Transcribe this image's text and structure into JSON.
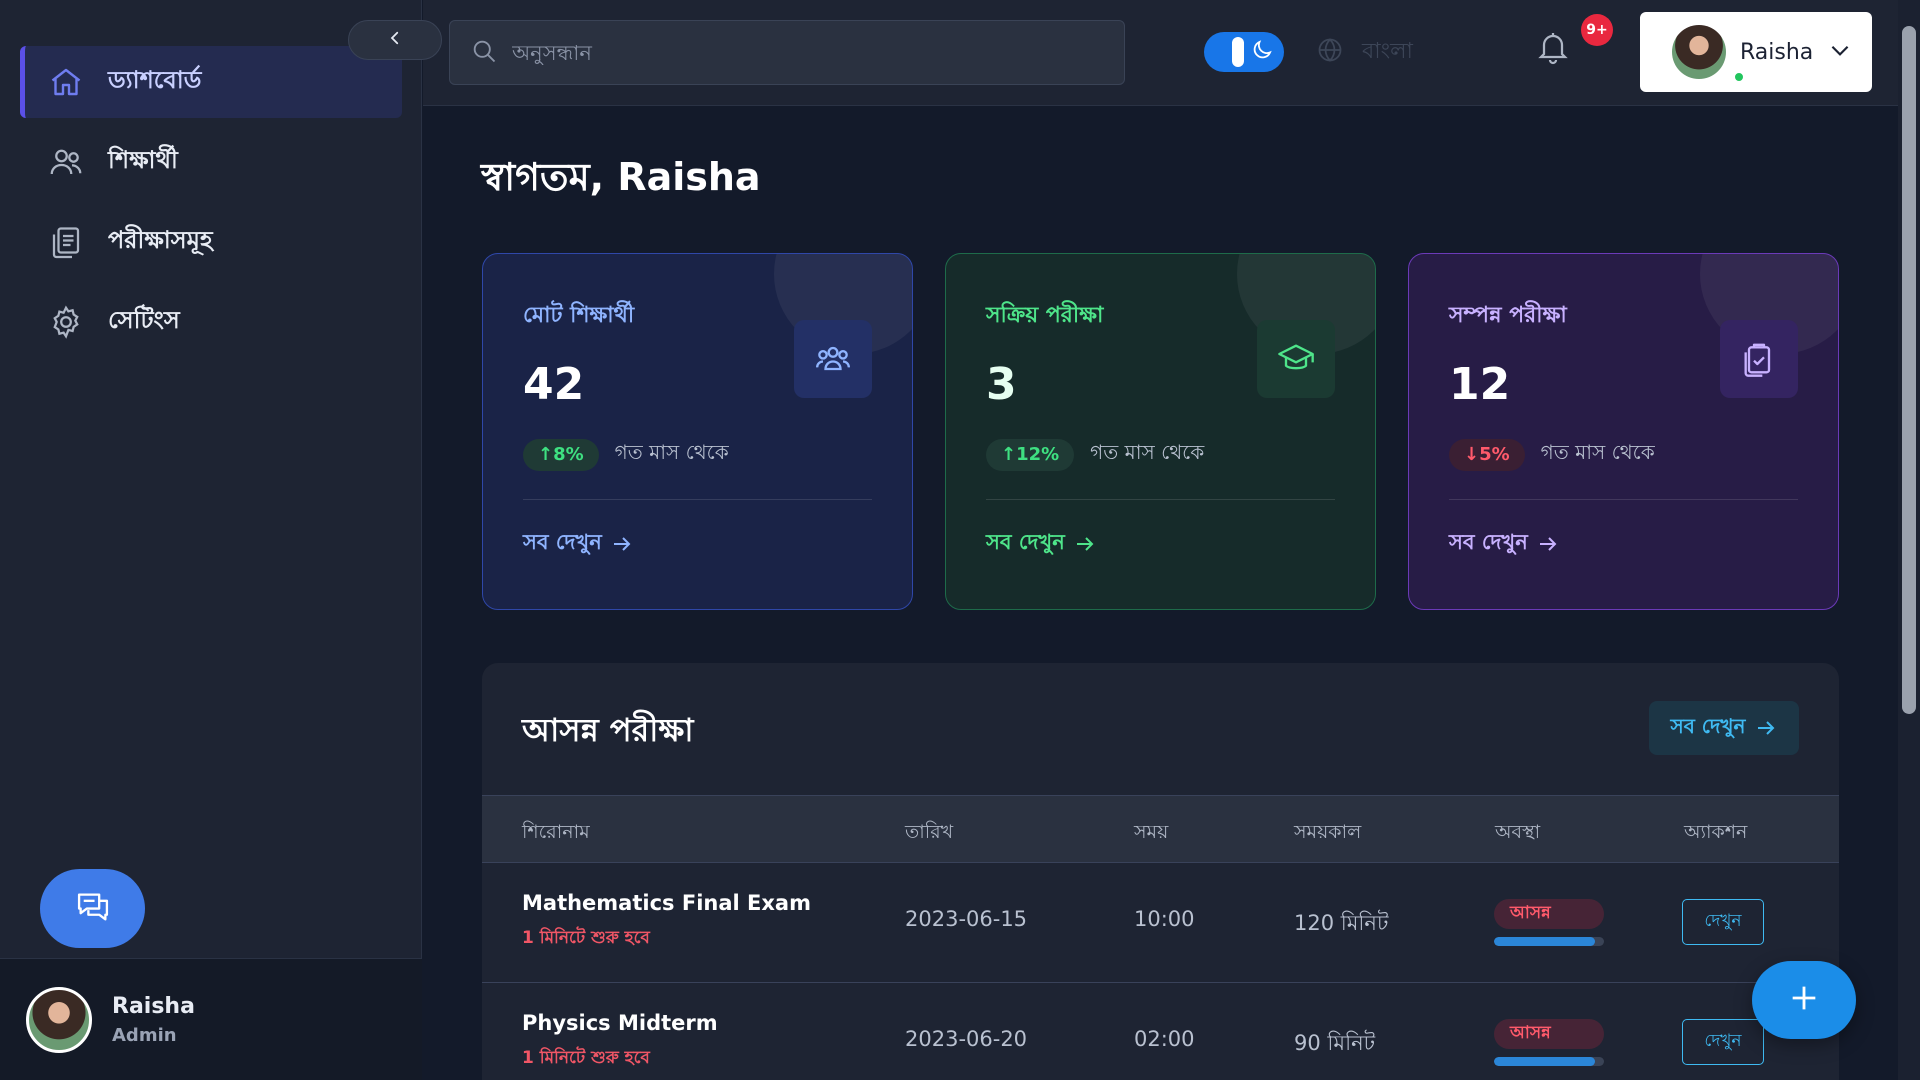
{
  "sidebar": {
    "items": [
      {
        "label": "ড্যাশবোর্ড",
        "icon": "home-icon",
        "active": true
      },
      {
        "label": "শিক্ষার্থী",
        "icon": "users-icon",
        "active": false
      },
      {
        "label": "পরীক্ষাসমূহ",
        "icon": "clipboard-list-icon",
        "active": false
      },
      {
        "label": "সেটিংস",
        "icon": "gear-icon",
        "active": false
      }
    ],
    "chat_icon": "chat-bubbles-icon",
    "user": {
      "name": "Raisha",
      "role": "Admin"
    }
  },
  "topbar": {
    "search": {
      "placeholder": "অনুসন্ধান",
      "value": ""
    },
    "theme": "dark",
    "language": "বাংলা",
    "notifications_badge": "9+",
    "user_name": "Raisha",
    "online": true
  },
  "welcome": "স্বাগতম, Raisha",
  "stats": [
    {
      "title": "মোট শিক্ষার্থী",
      "value": "42",
      "trend": "↑8%",
      "trend_dir": "up",
      "since": "গত মাস থেকে",
      "more": "সব দেখুন",
      "icon": "users-group-icon",
      "accent": "#8fb4ff"
    },
    {
      "title": "সক্রিয় পরীক্ষা",
      "value": "3",
      "trend": "↑12%",
      "trend_dir": "up",
      "since": "গত মাস থেকে",
      "more": "সব দেখুন",
      "icon": "graduation-cap-icon",
      "accent": "#4ee58a"
    },
    {
      "title": "সম্পন্ন পরীক্ষা",
      "value": "12",
      "trend": "↓5%",
      "trend_dir": "down",
      "since": "গত মাস থেকে",
      "more": "সব দেখুন",
      "icon": "clipboard-check-icon",
      "accent": "#c8b1ff"
    }
  ],
  "upcoming": {
    "title": "আসন্ন পরীক্ষা",
    "more": "সব দেখুন",
    "columns": [
      "শিরোনাম",
      "তারিখ",
      "সময়",
      "সময়কাল",
      "অবস্থা",
      "অ্যাকশন"
    ],
    "rows": [
      {
        "title": "Mathematics Final Exam",
        "sub": "1 মিনিটে শুরু হবে",
        "date": "2023-06-15",
        "time": "10:00",
        "duration": "120 মিনিট",
        "status": "আসন্ন",
        "progress": 0.92,
        "action": "দেখুন"
      },
      {
        "title": "Physics Midterm",
        "sub": "1 মিনিটে শুরু হবে",
        "date": "2023-06-20",
        "time": "02:00",
        "duration": "90 মিনিট",
        "status": "আসন্ন",
        "progress": 0.92,
        "action": "দেখুন"
      }
    ]
  },
  "fab": {
    "add_icon": "plus-icon"
  }
}
